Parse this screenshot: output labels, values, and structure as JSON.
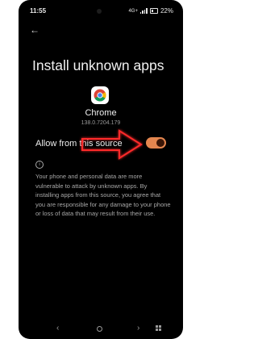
{
  "status_bar": {
    "time": "11:55",
    "network": "4G+",
    "battery": "22%"
  },
  "header": {
    "back_glyph": "←",
    "title": "Install unknown apps"
  },
  "app": {
    "name": "Chrome",
    "version": "138.0.7204.179",
    "icon": "chrome-logo"
  },
  "setting": {
    "label": "Allow from this source",
    "enabled": true,
    "accent_color": "#e4864f"
  },
  "info": {
    "icon_glyph": "i",
    "text": "Your phone and personal data are more vulnerable to attack by unknown apps. By installing apps from this source, you agree that you are responsible for any damage to your phone or loss of data that may result from their use."
  },
  "navbar": {
    "back_glyph": "‹",
    "recent_glyph": "›"
  },
  "annotation": {
    "type": "red-arrow-pointing-right",
    "color": "#ff2b2b"
  }
}
